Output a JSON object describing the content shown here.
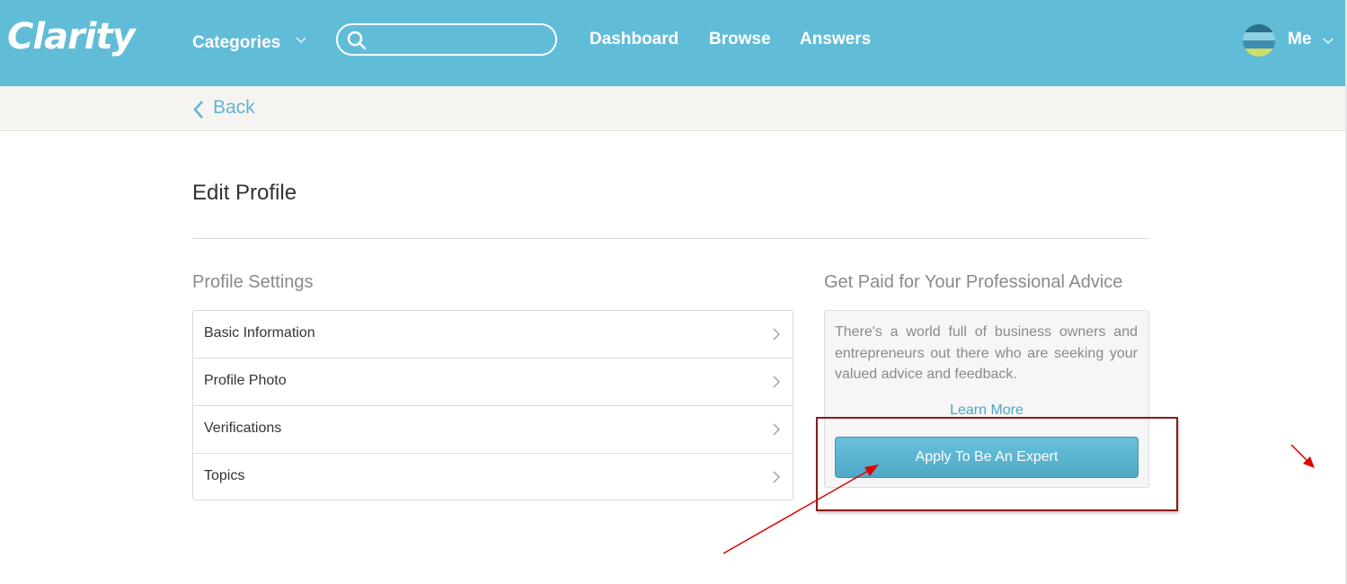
{
  "header": {
    "logo": "Clarity",
    "categories_label": "Categories",
    "search": {
      "value": "",
      "placeholder": ""
    },
    "nav": [
      "Dashboard",
      "Browse",
      "Answers"
    ],
    "user_label": "Me",
    "bg_color": "#61bcd8"
  },
  "subnav": {
    "back_label": "Back"
  },
  "page": {
    "title": "Edit Profile",
    "profile_settings": {
      "heading": "Profile Settings",
      "items": [
        {
          "label": "Basic Information",
          "icon": "chevron-right-icon"
        },
        {
          "label": "Profile Photo",
          "icon": "chevron-right-icon"
        },
        {
          "label": "Verifications",
          "icon": "chevron-right-icon"
        },
        {
          "label": "Topics",
          "icon": "chevron-right-icon"
        }
      ]
    },
    "expert": {
      "heading": "Get Paid for Your Professional Advice",
      "description": "There's a world full of business owners and entrepreneurs out there who are seeking your valued advice and feedback.",
      "learn_more": "Learn More",
      "apply_button": "Apply To Be An Expert"
    }
  },
  "annotations": {
    "highlight_color": "#8b1a1a",
    "arrow_color": "#e00000"
  }
}
